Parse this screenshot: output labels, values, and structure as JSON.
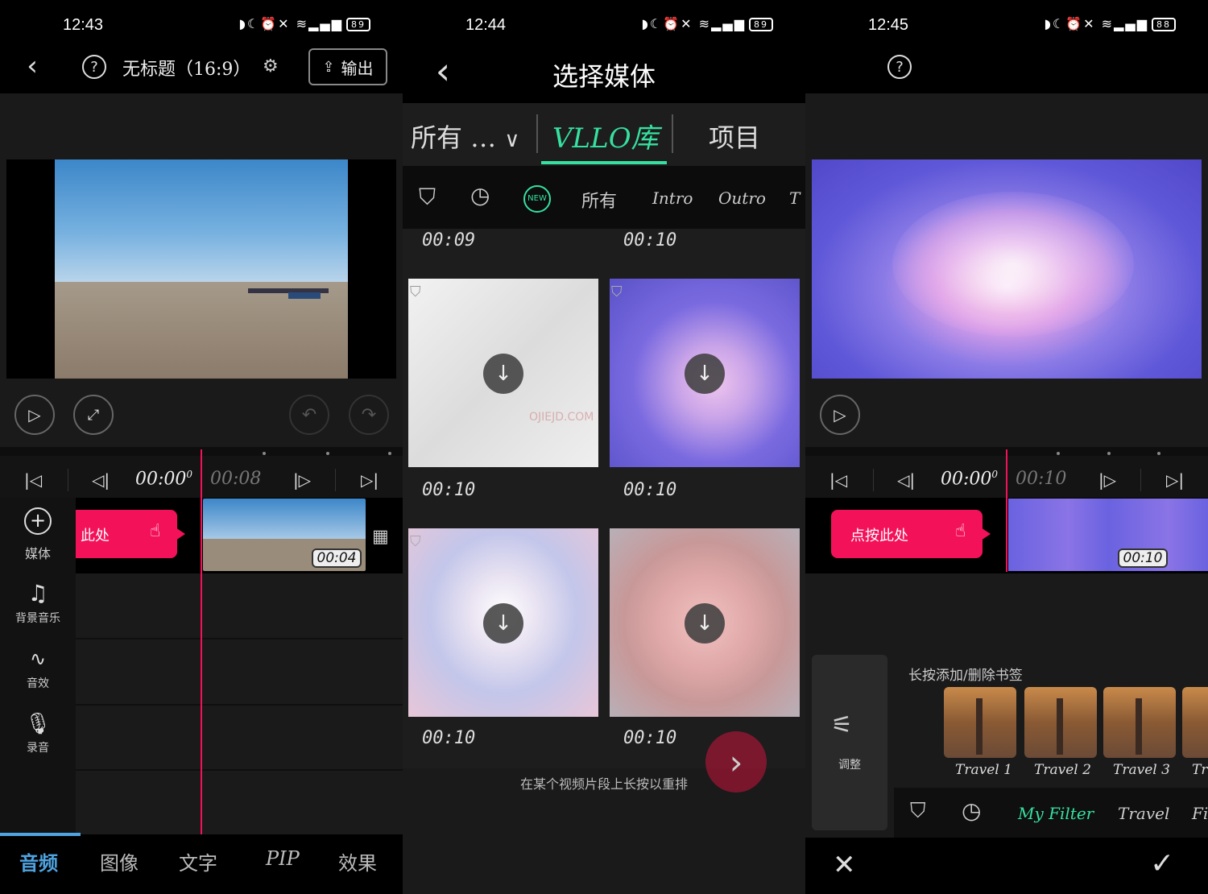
{
  "panel1": {
    "status": {
      "time": "12:43",
      "battery": "89"
    },
    "header": {
      "title": "无标题（16:9）",
      "export_label": "输出"
    },
    "timebar": {
      "current": "00:00",
      "current_sup": "0",
      "total": "00:08"
    },
    "tap_hint": "此处",
    "clip_duration": "00:04",
    "side": [
      {
        "label": "媒体",
        "icon": "plus-circle-icon"
      },
      {
        "label": "背景音乐",
        "icon": "music-note-icon"
      },
      {
        "label": "音效",
        "icon": "waveform-icon"
      },
      {
        "label": "录音",
        "icon": "microphone-icon"
      }
    ],
    "bottom_tabs": [
      "音频",
      "图像",
      "文字",
      "PIP",
      "效果"
    ],
    "active_tab_color": "#4fa3e0"
  },
  "panel2": {
    "status": {
      "time": "12:44",
      "battery": "89"
    },
    "title": "选择媒体",
    "source_tabs": {
      "all": "所有 … ",
      "vllo": "VLLO库",
      "project": "项目"
    },
    "category_tabs": [
      "所有",
      "Intro",
      "Outro",
      "T"
    ],
    "new_badge": "NEW",
    "top_durations": [
      "00:09",
      "00:10"
    ],
    "grid_durations": [
      "00:10",
      "00:10",
      "00:10",
      "00:10"
    ],
    "watermark": "OJIEJD.COM",
    "hint": "在某个视频片段上长按以重排",
    "accent_color": "#36e0a0"
  },
  "panel3": {
    "status": {
      "time": "12:45",
      "battery": "88"
    },
    "timebar": {
      "current": "00:00",
      "current_sup": "0",
      "total": "00:10"
    },
    "tap_label": "点按此处",
    "clip_duration": "00:10",
    "adjust_label": "调整",
    "hint": "长按添加/删除书签",
    "filters": [
      "Travel 1",
      "Travel 2",
      "Travel 3",
      "Tr"
    ],
    "filter_tabs": {
      "my": "My Filter",
      "travel": "Travel",
      "more": "Fi"
    }
  }
}
